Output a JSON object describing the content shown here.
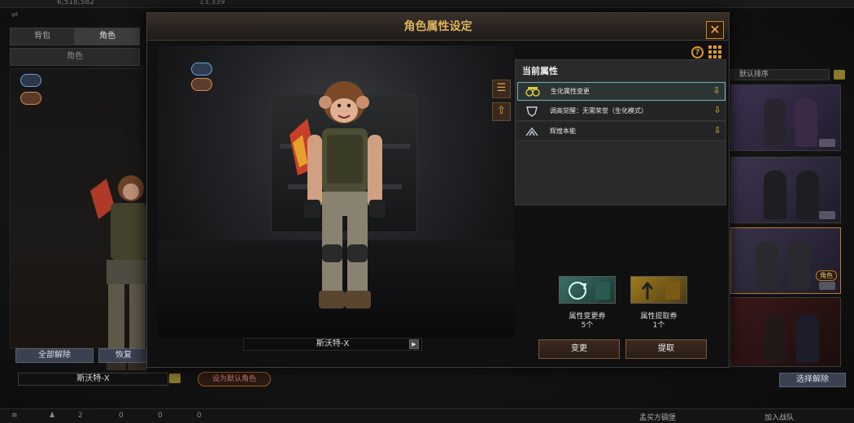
{
  "topbar": {
    "currency1": "6,518,582",
    "currency2": "13,339"
  },
  "left_panel": {
    "tabs": [
      "背包",
      "角色"
    ],
    "subtab": "角色",
    "buttons": {
      "unequip_all": "全部解除",
      "restore": "恢复"
    },
    "character_name": "斯沃特-X",
    "set_default": "设为默认角色"
  },
  "right_panel": {
    "sort_label": "默认排序",
    "role_tag": "角色",
    "select_unlock": "选择解除"
  },
  "bottombar": {
    "count_a": "2",
    "count_b": "0",
    "count_c": "0",
    "count_d": "0",
    "mode_label": "孟买方碉堡",
    "join_label": "加入战队"
  },
  "dialog": {
    "title": "角色属性设定",
    "help": "?",
    "character_name": "斯沃特-X",
    "current_attr_title": "当前属性",
    "attributes": [
      {
        "label": "生化属性变更",
        "icon": "biohazard-icon"
      },
      {
        "label": "调高觉醒：无需荣誉（生化模式）",
        "icon": "shield-icon"
      },
      {
        "label": "辉煌本能",
        "icon": "wings-icon"
      }
    ],
    "tickets": [
      {
        "name": "属性变更券",
        "count": "5个"
      },
      {
        "name": "属性提取券",
        "count": "1个"
      }
    ],
    "buttons": {
      "change": "变更",
      "extract": "提取"
    }
  },
  "colors": {
    "accent": "#ddb35a",
    "orange": "#e09a2a",
    "teal_select": "#6fb3b0"
  }
}
